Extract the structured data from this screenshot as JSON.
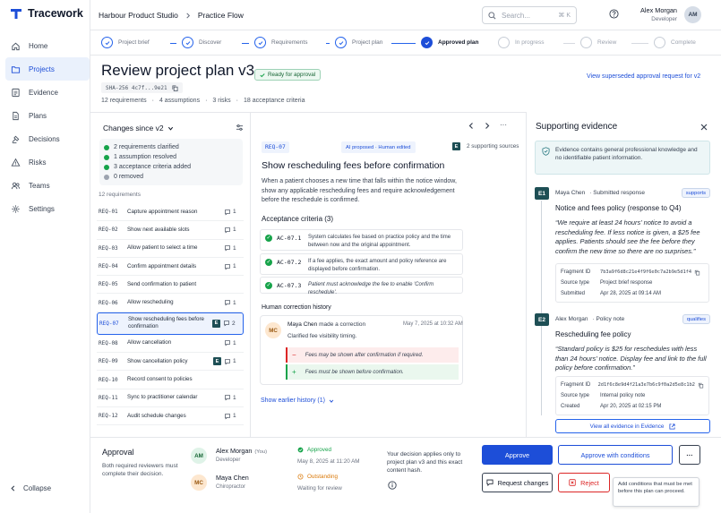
{
  "app": {
    "name": "Tracework"
  },
  "sidebar": {
    "items": [
      {
        "label": "Home",
        "icon": "home-icon"
      },
      {
        "label": "Projects",
        "icon": "folder-icon",
        "active": true
      },
      {
        "label": "Evidence",
        "icon": "evidence-icon"
      },
      {
        "label": "Plans",
        "icon": "document-icon"
      },
      {
        "label": "Decisions",
        "icon": "decisions-icon"
      },
      {
        "label": "Risks",
        "icon": "warning-icon"
      },
      {
        "label": "Teams",
        "icon": "users-icon"
      },
      {
        "label": "Settings",
        "icon": "gear-icon"
      }
    ],
    "collapse_label": "Collapse"
  },
  "topbar": {
    "breadcrumb": [
      "Harbour Product Studio",
      "Practice Flow"
    ],
    "search_placeholder": "Search...",
    "search_shortcut": "⌘ K",
    "user_name": "Alex Morgan",
    "user_role": "Developer",
    "user_initials": "AM"
  },
  "stepper": {
    "steps": [
      "Project brief",
      "Discover",
      "Requirements",
      "Project plan",
      "Approved plan",
      "In progress",
      "Review",
      "Complete"
    ],
    "current_index": 4
  },
  "header": {
    "title": "Review project plan v3",
    "status_badge": "Ready for approval",
    "hash": "SHA-256 4c7f...9e21",
    "meta": [
      "12 requirements",
      "·",
      "4 assumptions",
      "·",
      "3 risks",
      "·",
      "18 acceptance criteria"
    ],
    "superseded_link": "View superseded approval request for v2"
  },
  "changes": {
    "title": "Changes since v2",
    "summary": [
      {
        "text": "2 requirements clarified",
        "color": "#16a34a"
      },
      {
        "text": "1 assumption resolved",
        "color": "#16a34a"
      },
      {
        "text": "3 acceptance criteria added",
        "color": "#16a34a"
      },
      {
        "text": "0 removed",
        "color": "#9ca3af"
      }
    ],
    "requirements_count": "12 requirements",
    "requirements": [
      {
        "id": "REQ-01",
        "name": "Capture appointment reason",
        "comments": "1"
      },
      {
        "id": "REQ-02",
        "name": "Show next available slots",
        "comments": "1"
      },
      {
        "id": "REQ-03",
        "name": "Allow patient to select a time",
        "comments": "1"
      },
      {
        "id": "REQ-04",
        "name": "Confirm appointment details",
        "comments": "1"
      },
      {
        "id": "REQ-05",
        "name": "Send confirmation to patient",
        "comments": ""
      },
      {
        "id": "REQ-06",
        "name": "Allow rescheduling",
        "comments": "1"
      },
      {
        "id": "REQ-07",
        "name": "Show rescheduling fees before confirmation",
        "comments": "2",
        "evidence": true,
        "selected": true
      },
      {
        "id": "REQ-08",
        "name": "Allow cancellation",
        "comments": "1"
      },
      {
        "id": "REQ-09",
        "name": "Show cancellation policy",
        "comments": "1",
        "evidence": true
      },
      {
        "id": "REQ-10",
        "name": "Record consent to policies",
        "comments": ""
      },
      {
        "id": "REQ-11",
        "name": "Sync to practitioner calendar",
        "comments": "1"
      },
      {
        "id": "REQ-12",
        "name": "Audit schedule changes",
        "comments": "1"
      }
    ]
  },
  "detail": {
    "req_id": "REQ-07",
    "ai_tag": "AI proposed · Human edited",
    "sources": "2 supporting sources",
    "evidence_badge": "E",
    "title": "Show rescheduling fees before confirmation",
    "description": "When a patient chooses a new time that falls within the notice window, show any applicable rescheduling fees and require acknowledgement before the reschedule is confirmed.",
    "acceptance_title": "Acceptance criteria",
    "acceptance_count": "(3)",
    "criteria": [
      {
        "id": "AC-07.1",
        "text": "System calculates fee based on practice policy and the time between now and the original appointment.",
        "italic": false
      },
      {
        "id": "AC-07.2",
        "text": "If a fee applies, the exact amount and policy reference are displayed before confirmation.",
        "italic": false
      },
      {
        "id": "AC-07.3",
        "text": "Patient must acknowledge the fee to enable 'Confirm reschedule'.",
        "italic": true
      }
    ],
    "history_title": "Human correction history",
    "history": {
      "initials": "MC",
      "author": "Maya Chen",
      "action": "made a correction",
      "time": "May 7, 2025 at 10:32 AM",
      "note": "Clarified fee visibility timing.",
      "removed": "Fees may be shown after confirmation if required.",
      "added": "Fees must be shown before confirmation."
    },
    "earlier_link": "Show earlier history (1)"
  },
  "evidence": {
    "title": "Supporting evidence",
    "notice": "Evidence contains general professional knowledge and no identifiable patient information.",
    "items": [
      {
        "badge": "E1",
        "author": "Maya Chen",
        "kind": "· Submitted response",
        "relation": "supports",
        "name": "Notice and fees policy (response to Q4)",
        "quote": "“We require at least 24 hours' notice to avoid a rescheduling fee. If less notice is given, a $25 fee applies. Patients should see the fee before they confirm the new time so there are no surprises.”",
        "fields": [
          {
            "k": "Fragment ID",
            "v": "7b3a9f6d8c21e4f9f6e0c7a2b9e5d1f4"
          },
          {
            "k": "Source type",
            "v": "Project brief response"
          },
          {
            "k": "Submitted",
            "v": "Apr 28, 2025 at 09:14 AM"
          }
        ]
      },
      {
        "badge": "E2",
        "author": "Alex Morgan",
        "kind": "· Policy note",
        "relation": "qualifies",
        "name": "Rescheduling fee policy",
        "quote": "“Standard policy is $25 for reschedules with less than 24 hours' notice. Display fee and link to the full policy before confirmation.”",
        "fields": [
          {
            "k": "Fragment ID",
            "v": "2d1f6c8e9d4f21a3e7b6c9f0a2d5e8c1b2"
          },
          {
            "k": "Source type",
            "v": "Internal policy note"
          },
          {
            "k": "Created",
            "v": "Apr 20, 2025 at 02:15 PM"
          }
        ]
      }
    ],
    "view_all": "View all evidence in Evidence"
  },
  "approval": {
    "title": "Approval",
    "description": "Both required reviewers must complete their decision.",
    "reviewers": [
      {
        "initials": "AM",
        "name": "Alex Morgan",
        "you": "(You)",
        "role": "Developer",
        "status": "Approved",
        "detail": "May 8, 2025 at 11:20 AM",
        "status_color": "#16a34a",
        "avatar_bg": "#dff3e8",
        "avatar_fg": "#166534"
      },
      {
        "initials": "MC",
        "name": "Maya Chen",
        "you": "",
        "role": "Chiropractor",
        "status": "Outstanding",
        "detail": "Waiting for review",
        "status_color": "#d97706",
        "avatar_bg": "#fde7cf",
        "avatar_fg": "#9a5a13"
      }
    ],
    "decision_note": "Your decision applies only to project plan v3 and this exact content hash.",
    "buttons": {
      "approve": "Approve",
      "approve_conditions": "Approve with conditions",
      "more": "···",
      "request_changes": "Request changes",
      "reject": "Reject"
    },
    "tooltip": "Add conditions that must be met before this plan can proceed."
  },
  "colors": {
    "primary": "#1d4ed8",
    "success": "#16a34a",
    "danger": "#dc2626",
    "evidence_teal": "#1e4f55"
  }
}
